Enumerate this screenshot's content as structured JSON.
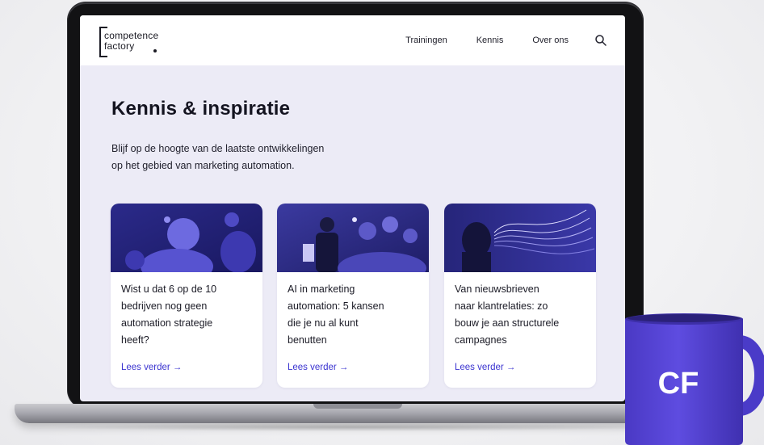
{
  "nav": {
    "logo_line1": "competence",
    "logo_line2": "factory",
    "items": [
      "Trainingen",
      "Kennis",
      "Over ons"
    ]
  },
  "hero": {
    "title": "Kennis & inspiratie",
    "subtitle_line1": "Blijf op de hoogte van de laatste ontwikkelingen",
    "subtitle_line2": "op het gebied van marketing automation."
  },
  "cards": [
    {
      "title_lines": [
        "Wist u dat 6 op de 10",
        "bedrijven nog geen",
        "automation strategie",
        "heeft?"
      ],
      "link": "Lees verder →"
    },
    {
      "title_lines": [
        "AI in marketing",
        "automation: 5 kansen",
        "die je nu al kunt",
        "benutten"
      ],
      "link": "Lees verder →"
    },
    {
      "title_lines": [
        "Van nieuwsbrieven",
        "naar klantrelaties: zo",
        "bouw je aan structurele",
        "campagnes"
      ],
      "link": "Lees verder →"
    }
  ],
  "mug": {
    "label": "CF",
    "color": "#5b49d8"
  },
  "colors": {
    "accent": "#3a33d0",
    "screen_bg": "#ecebf6",
    "illustration": "#4b42c4"
  }
}
